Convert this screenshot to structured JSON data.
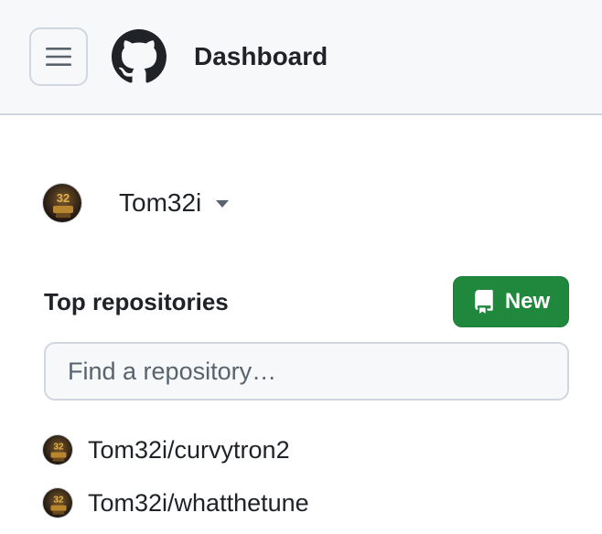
{
  "header": {
    "title": "Dashboard",
    "menu_icon": "hamburger-menu-icon",
    "logo_icon": "github-octocat-logo"
  },
  "user": {
    "name": "Tom32i",
    "avatar_icon": "user-avatar",
    "caret_icon": "triangle-down-icon"
  },
  "repositories": {
    "title": "Top repositories",
    "new_button_label": "New",
    "new_button_icon": "repo-icon",
    "search_placeholder": "Find a repository…",
    "items": [
      {
        "name": "Tom32i/curvytron2"
      },
      {
        "name": "Tom32i/whatthetune"
      }
    ]
  },
  "colors": {
    "header_bg": "#f6f8fa",
    "border": "#d0d7de",
    "primary_button": "#1f883d",
    "text": "#1f2328"
  }
}
